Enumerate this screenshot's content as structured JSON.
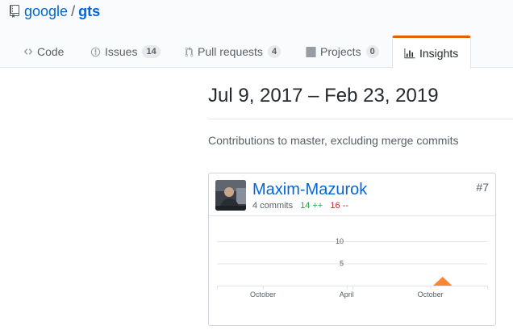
{
  "repo": {
    "owner": "google",
    "separator": "/",
    "name": "gts"
  },
  "tabs": [
    {
      "label": "Code",
      "icon": "code-icon"
    },
    {
      "label": "Issues",
      "icon": "issue-icon",
      "count": "14"
    },
    {
      "label": "Pull requests",
      "icon": "pull-request-icon",
      "count": "4"
    },
    {
      "label": "Projects",
      "icon": "project-icon",
      "count": "0"
    },
    {
      "label": "Insights",
      "icon": "graph-icon",
      "selected": true
    }
  ],
  "date_range": "Jul 9, 2017 – Feb 23, 2019",
  "subtitle": "Contributions to master, excluding merge commits",
  "contributor": {
    "name": "Maxim-Mazurok",
    "commits": "4 commits",
    "additions": "14 ++",
    "deletions": "16 --",
    "rank": "#7"
  },
  "colors": {
    "accent": "#e36209",
    "link": "#0366d6",
    "add": "#28a745",
    "del": "#cb2431",
    "chart_fill": "#fb8532"
  },
  "chart_data": {
    "type": "area",
    "y_ticks": [
      5,
      10
    ],
    "ylim": [
      0,
      12
    ],
    "x_tick_labels": [
      "October",
      "April",
      "October"
    ],
    "x_tick_positions": [
      0.17,
      0.48,
      0.79
    ],
    "grid": true,
    "series": [
      {
        "x": [
          0.0,
          0.8,
          0.835,
          0.87,
          1.0
        ],
        "values": [
          0,
          0,
          2,
          0,
          0
        ]
      }
    ]
  }
}
